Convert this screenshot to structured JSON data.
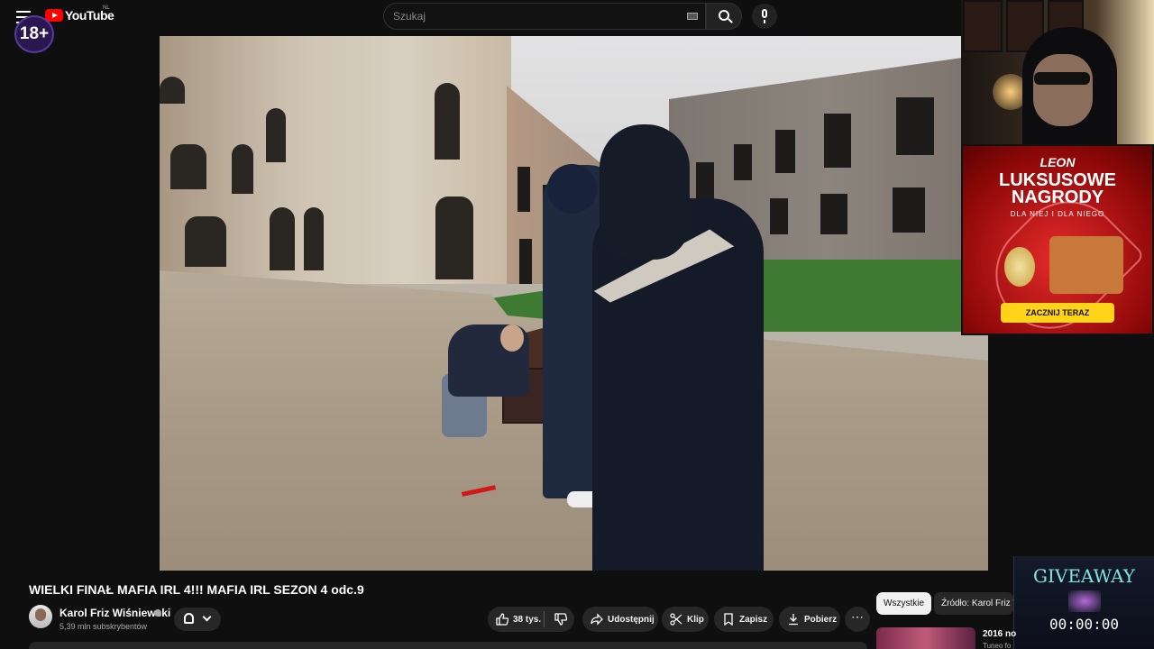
{
  "header": {
    "logo_text": "YouTube",
    "country_code": "NL",
    "search_placeholder": "Szukaj"
  },
  "overlay": {
    "age_badge": "18+",
    "giveaway_title": "GIVEAWAY",
    "giveaway_timer": "00:00:00"
  },
  "ad": {
    "brand": "LEON",
    "headline_line1": "LUKSUSOWE",
    "headline_line2": "NAGRODY",
    "subline": "DLA NIEJ  I  DLA NIEGO",
    "cta": "ZACZNIJ TERAZ",
    "colors": {
      "background": "#c31616",
      "cta": "#ffd31a"
    }
  },
  "video": {
    "title": "WIELKI FINAŁ MAFIA IRL 4!!! MAFIA IRL SEZON 4 odc.9"
  },
  "channel": {
    "name": "Karol Friz Wiśniewski",
    "subscribers": "5,39 mln subskrybentów"
  },
  "actions": {
    "likes": "38 tys.",
    "share": "Udostępnij",
    "clip": "Klip",
    "save": "Zapisz",
    "download": "Pobierz",
    "more": "⋯"
  },
  "sidebar": {
    "chips": [
      "Wszystkie",
      "Źródło: Karol Friz Wiśniewski"
    ],
    "rec_title": "2016 no",
    "rec_sub": "Tuneo fo"
  },
  "icons": [
    "menu-icon",
    "search-icon",
    "keyboard-icon",
    "mic-icon",
    "bell-icon",
    "chevron-down-icon",
    "thumbs-up-icon",
    "thumbs-down-icon",
    "share-icon",
    "scissors-icon",
    "bookmark-icon",
    "download-icon",
    "more-icon",
    "verified-icon"
  ]
}
